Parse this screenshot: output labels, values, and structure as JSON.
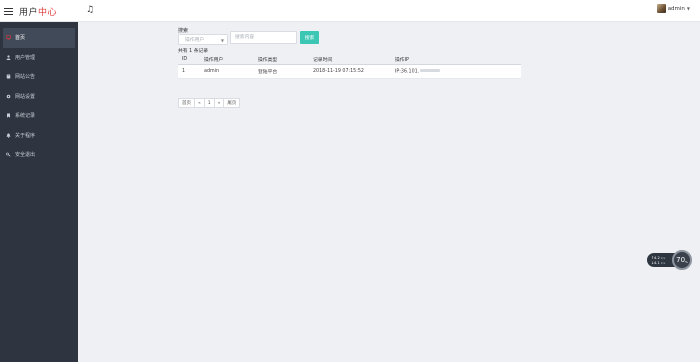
{
  "header": {
    "brand_main": "用户",
    "brand_accent": "中心",
    "username": "admin"
  },
  "sidebar": {
    "items": [
      {
        "label": "首页",
        "icon": "monitor-icon",
        "active": true
      },
      {
        "label": "用户管理",
        "icon": "user-icon",
        "active": false
      },
      {
        "label": "网站公告",
        "icon": "book-icon",
        "active": false
      },
      {
        "label": "网站设置",
        "icon": "gear-icon",
        "active": false
      },
      {
        "label": "系统记录",
        "icon": "bookmark-icon",
        "active": false
      },
      {
        "label": "关于程序",
        "icon": "bell-icon",
        "active": false
      },
      {
        "label": "安全退出",
        "icon": "key-icon",
        "active": false
      }
    ]
  },
  "search": {
    "label": "搜索",
    "select_value": "操作用户",
    "input_placeholder": "搜索内容",
    "button_label": "搜索",
    "record_count": "共有 1 条记录"
  },
  "table": {
    "columns": [
      "ID",
      "操作用户",
      "操作类型",
      "记录时间",
      "操作IP"
    ],
    "rows": [
      {
        "id": "1",
        "user": "admin",
        "type": "登陆平台",
        "time": "2018-11-19 07:15:52",
        "ip": "IP:36.101."
      }
    ]
  },
  "pager": {
    "first": "首页",
    "prev": "«",
    "current": "1",
    "next": "»",
    "last": "尾页"
  },
  "speed_widget": {
    "up_value": "4.2",
    "up_unit": "K/s",
    "down_value": "4.1",
    "down_unit": "K/s",
    "percent": "70",
    "percent_unit": "%"
  },
  "colors": {
    "sidebar_bg": "#2e3440",
    "accent_red": "#e23b3b",
    "button_teal": "#3cc6b4",
    "content_bg": "#eef0f4"
  }
}
